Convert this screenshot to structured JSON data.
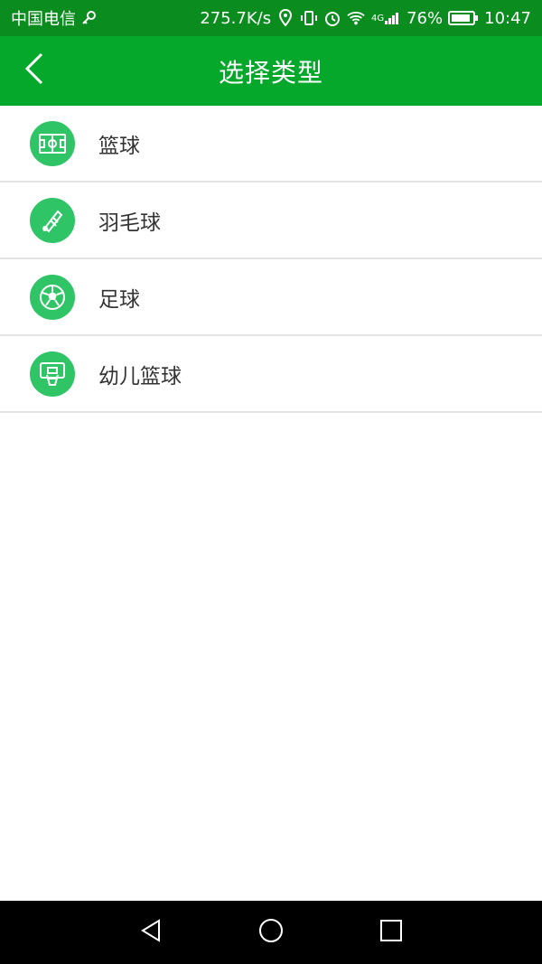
{
  "status_bar": {
    "carrier": "中国电信",
    "speed": "275.7K/s",
    "battery": "76%",
    "time": "10:47",
    "network": "4G"
  },
  "header": {
    "title": "选择类型",
    "back_icon": "chevron-left-icon",
    "bg_color": "#05a82a"
  },
  "list": {
    "items": [
      {
        "label": "篮球",
        "icon": "basketball-court-icon"
      },
      {
        "label": "羽毛球",
        "icon": "shuttlecock-icon"
      },
      {
        "label": "足球",
        "icon": "soccer-ball-icon"
      },
      {
        "label": "幼儿篮球",
        "icon": "basketball-hoop-icon"
      }
    ],
    "icon_color": "#2fc466"
  },
  "nav_bar": {
    "back": "triangle-back-icon",
    "home": "circle-home-icon",
    "recent": "square-recent-icon"
  }
}
